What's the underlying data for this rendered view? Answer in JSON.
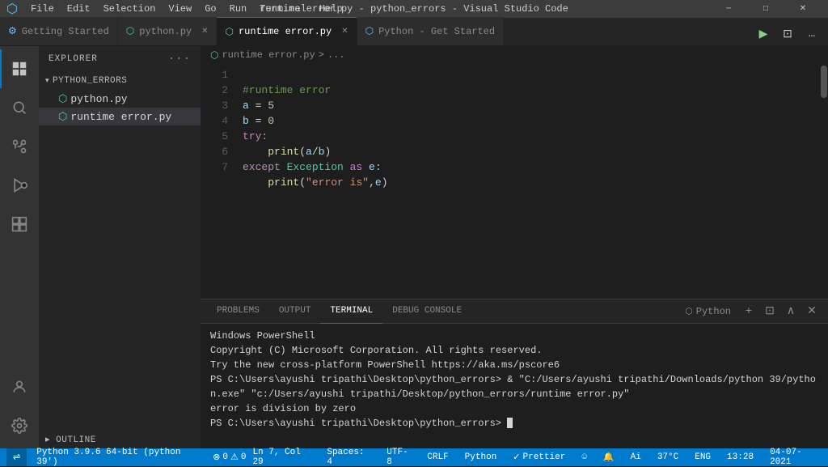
{
  "titleBar": {
    "title": "runtime error.py - python_errors - Visual Studio Code",
    "menuItems": [
      "File",
      "Edit",
      "Selection",
      "View",
      "Go",
      "Run",
      "Terminal",
      "Help"
    ],
    "appIcon": "⬡",
    "winMinimize": "─",
    "winMaximize": "□",
    "winClose": "✕"
  },
  "tabs": [
    {
      "id": "getting-started",
      "label": "Getting Started",
      "icon": "⚙",
      "active": false,
      "closable": false
    },
    {
      "id": "python-py",
      "label": "python.py",
      "icon": "🐍",
      "active": false,
      "closable": true
    },
    {
      "id": "runtime-error-py",
      "label": "runtime error.py",
      "icon": "🐍",
      "active": true,
      "closable": true
    },
    {
      "id": "python-get-started",
      "label": "Python - Get Started",
      "icon": "🐍",
      "active": false,
      "closable": false
    }
  ],
  "sidebar": {
    "header": "Explorer",
    "section": "PYTHON_ERRORS",
    "files": [
      {
        "name": "python.py",
        "icon": "🐍",
        "active": false
      },
      {
        "name": "runtime error.py",
        "icon": "🐍",
        "active": true
      }
    ]
  },
  "breadcrumb": {
    "path": "runtime error.py",
    "separator": ">",
    "items": [
      "runtime error.py",
      "..."
    ]
  },
  "code": {
    "lines": [
      {
        "num": 1,
        "content": [
          {
            "type": "comment",
            "text": "#runtime error"
          }
        ]
      },
      {
        "num": 2,
        "content": [
          {
            "type": "var",
            "text": "a"
          },
          {
            "type": "op",
            "text": " = "
          },
          {
            "type": "num",
            "text": "5"
          }
        ]
      },
      {
        "num": 3,
        "content": [
          {
            "type": "var",
            "text": "b"
          },
          {
            "type": "op",
            "text": " = "
          },
          {
            "type": "num",
            "text": "0"
          }
        ]
      },
      {
        "num": 4,
        "content": [
          {
            "type": "kw",
            "text": "try:"
          }
        ]
      },
      {
        "num": 5,
        "content": [
          {
            "type": "fn",
            "text": "    print"
          },
          {
            "type": "op",
            "text": "("
          },
          {
            "type": "var",
            "text": "a"
          },
          {
            "type": "op",
            "text": "/"
          },
          {
            "type": "var",
            "text": "b"
          },
          {
            "type": "op",
            "text": ")"
          }
        ]
      },
      {
        "num": 6,
        "content": [
          {
            "type": "kw",
            "text": "except "
          },
          {
            "type": "exc",
            "text": "Exception"
          },
          {
            "type": "kw",
            "text": " as "
          },
          {
            "type": "var",
            "text": "e:"
          }
        ]
      },
      {
        "num": 7,
        "content": [
          {
            "type": "fn",
            "text": "    print"
          },
          {
            "type": "op",
            "text": "("
          },
          {
            "type": "str",
            "text": "\"error is\""
          },
          {
            "type": "op",
            "text": ","
          },
          {
            "type": "var",
            "text": "e"
          },
          {
            "type": "op",
            "text": ")"
          }
        ]
      }
    ]
  },
  "terminal": {
    "tabs": [
      "PROBLEMS",
      "OUTPUT",
      "TERMINAL",
      "DEBUG CONSOLE"
    ],
    "activeTab": "TERMINAL",
    "pythonLabel": "Python",
    "lines": [
      {
        "text": "Windows PowerShell"
      },
      {
        "text": "Copyright (C) Microsoft Corporation. All rights reserved."
      },
      {
        "text": ""
      },
      {
        "text": "Try the new cross-platform PowerShell https://aka.ms/pscore6"
      },
      {
        "text": ""
      },
      {
        "text": "PS C:\\Users\\ayushi tripathi\\Desktop\\python_errors> & \"C:/Users/ayushi tripathi/Downloads/python 39/python.exe\" \"c:/Users/ayushi tripathi/Desktop/python_errors/runtime error.py\""
      },
      {
        "text": "error is division by zero"
      },
      {
        "text": "PS C:\\Users\\ayushi tripathi\\Desktop\\python_errors> "
      }
    ]
  },
  "statusBar": {
    "left": {
      "gitBranch": "⎇",
      "pythonVersion": "Python 3.9.6 64-bit (python 39')",
      "errors": "0",
      "warnings": "0"
    },
    "right": {
      "ln": "Ln 7, Col 29",
      "spaces": "Spaces: 4",
      "encoding": "UTF-8",
      "lineEnding": "CRLF",
      "language": "Python",
      "prettier": "Prettier",
      "feedback": "☺",
      "notifications": "🔔",
      "temp": "37°C",
      "time": "13:28",
      "date": "04-07-2021",
      "lang": "ENG"
    }
  }
}
